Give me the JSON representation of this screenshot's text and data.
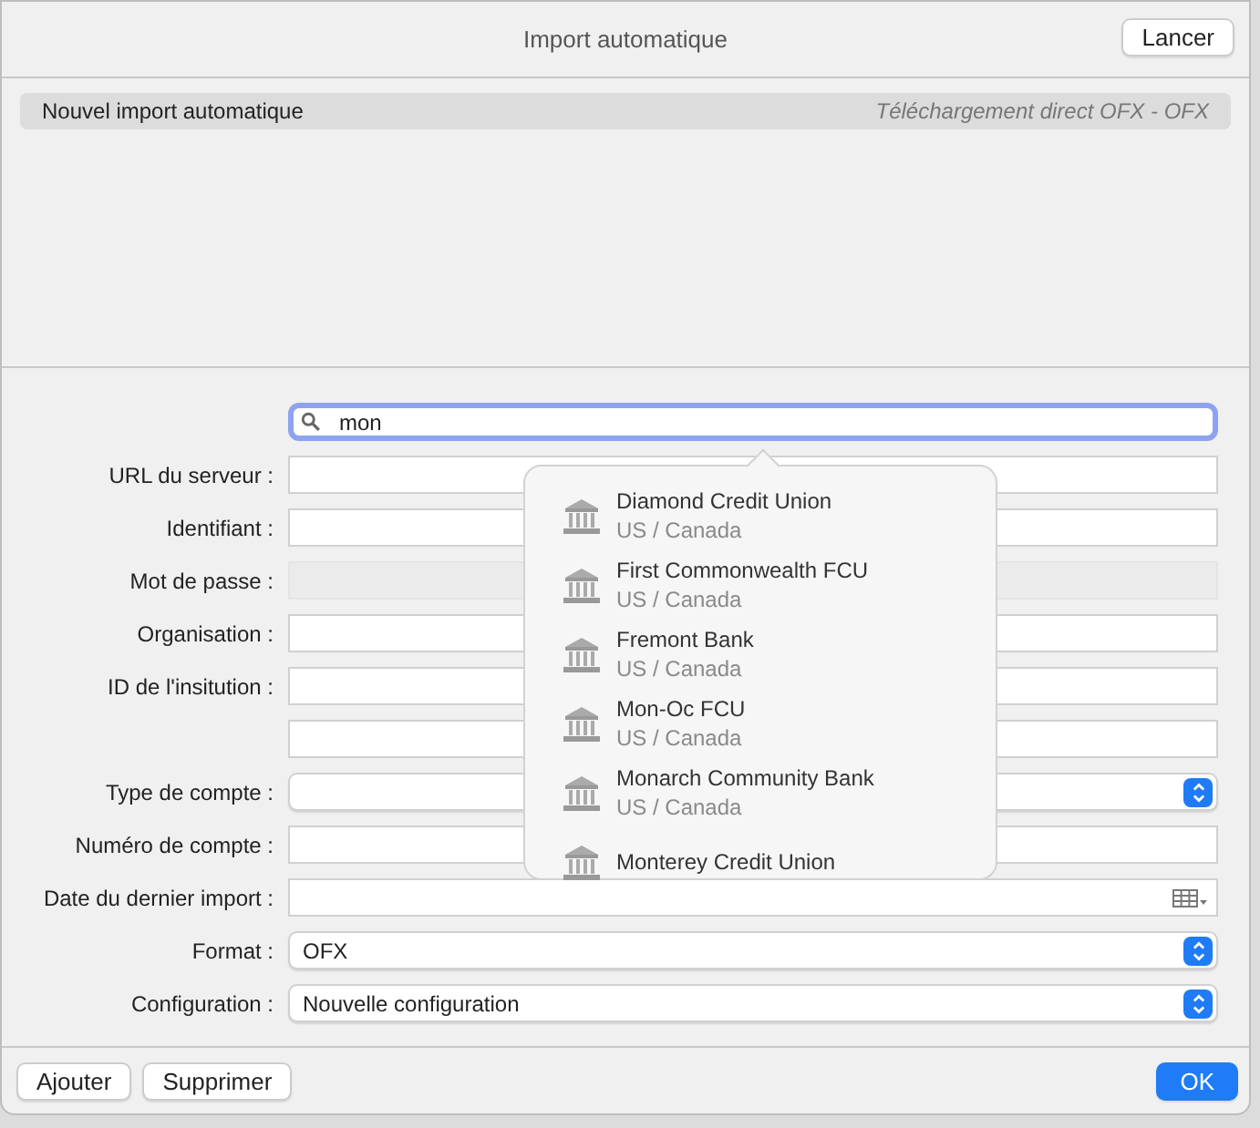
{
  "window": {
    "title": "Import automatique"
  },
  "toolbar": {
    "run_button": "Lancer"
  },
  "imports": [
    {
      "name": "Nouvel import automatique",
      "detail": "Téléchargement direct OFX - OFX",
      "selected": true
    }
  ],
  "search": {
    "value": "mon"
  },
  "fields": [
    {
      "kind": "text",
      "label": "URL du serveur :"
    },
    {
      "kind": "text",
      "label": "Identifiant :"
    },
    {
      "kind": "text",
      "label": "Mot de passe :",
      "disabled": true
    },
    {
      "kind": "text",
      "label": "Organisation :"
    },
    {
      "kind": "text",
      "label": "ID de l'insitution :"
    },
    {
      "kind": "text"
    },
    {
      "kind": "popup",
      "label": "Type de compte :"
    },
    {
      "kind": "text",
      "label": "Numéro de compte :"
    },
    {
      "kind": "date",
      "label": "Date du dernier import :"
    },
    {
      "kind": "popup",
      "label": "Format :",
      "value": "OFX"
    },
    {
      "kind": "popup",
      "label": "Configuration :",
      "value": "Nouvelle configuration"
    }
  ],
  "suggestions": [
    {
      "name": "Diamond Credit Union",
      "region": "US / Canada"
    },
    {
      "name": "First Commonwealth FCU",
      "region": "US / Canada"
    },
    {
      "name": "Fremont Bank",
      "region": "US / Canada"
    },
    {
      "name": "Mon-Oc FCU",
      "region": "US / Canada"
    },
    {
      "name": "Monarch Community Bank",
      "region": "US / Canada"
    },
    {
      "name": "Monterey Credit Union"
    }
  ],
  "footer": {
    "left_buttons": [
      "Ajouter",
      "Supprimer"
    ],
    "ok_button": "OK"
  }
}
